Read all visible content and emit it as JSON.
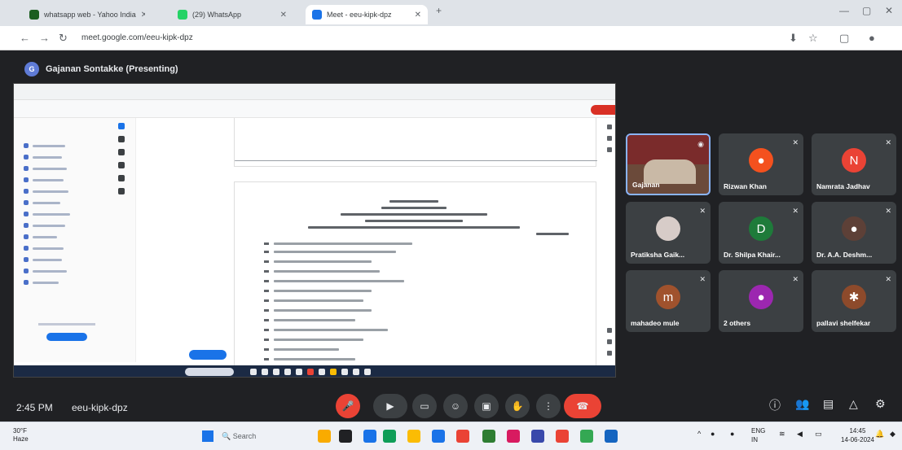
{
  "browser": {
    "tabs": [
      {
        "label": "whatsapp web - Yahoo India",
        "fav": "#1b5e20"
      },
      {
        "label": "(29) WhatsApp",
        "fav": "#25d366"
      },
      {
        "label": "Meet - eeu-kipk-dpz",
        "fav": "#1a73e8"
      }
    ],
    "new_tab": "+",
    "url": "meet.google.com/eeu-kipk-dpz"
  },
  "meet": {
    "presenter_initial": "G",
    "presenter_label": "Gajanan Sontakke (Presenting)",
    "time": "2:45 PM",
    "meeting_code": "eeu-kipk-dpz"
  },
  "participants": [
    {
      "name": "Gajanan",
      "initial": "",
      "color": "",
      "video": true
    },
    {
      "name": "Rizwan Khan",
      "initial": "",
      "color": "#f4511e",
      "video": false
    },
    {
      "name": "Namrata Jadhav",
      "initial": "N",
      "color": "#ea4335",
      "video": false
    },
    {
      "name": "Pratiksha Gaik...",
      "initial": "",
      "color": "#d7ccc8",
      "video": false
    },
    {
      "name": "Dr. Shilpa Khair...",
      "initial": "D",
      "color": "#1e7b3a",
      "video": false
    },
    {
      "name": "Dr. A.A. Deshm...",
      "initial": "",
      "color": "#5d4037",
      "video": false
    },
    {
      "name": "mahadeo mule",
      "initial": "m",
      "color": "#a0522d",
      "video": false
    },
    {
      "name": "2 others",
      "initial": "",
      "color": "#9c27b0",
      "video": false
    },
    {
      "name": "pallavi shelfekar",
      "initial": "",
      "color": "#8d4a2b",
      "video": false
    }
  ],
  "taskbar": {
    "temp": "30°F",
    "weather": "Haze",
    "search_placeholder": "Search",
    "lang": "ENG",
    "region": "IN",
    "clock_time": "14:45",
    "clock_date": "14-06-2024"
  },
  "colors": {
    "accent": "#1a73e8",
    "end_call": "#ea4335"
  }
}
